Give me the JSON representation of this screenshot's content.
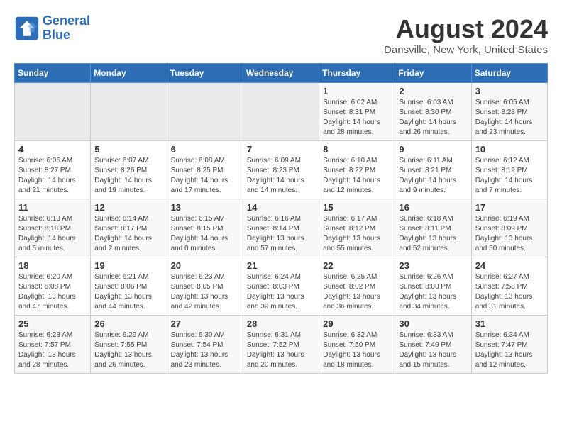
{
  "header": {
    "logo_line1": "General",
    "logo_line2": "Blue",
    "month_title": "August 2024",
    "location": "Dansville, New York, United States"
  },
  "days_of_week": [
    "Sunday",
    "Monday",
    "Tuesday",
    "Wednesday",
    "Thursday",
    "Friday",
    "Saturday"
  ],
  "weeks": [
    [
      {
        "day": "",
        "info": ""
      },
      {
        "day": "",
        "info": ""
      },
      {
        "day": "",
        "info": ""
      },
      {
        "day": "",
        "info": ""
      },
      {
        "day": "1",
        "info": "Sunrise: 6:02 AM\nSunset: 8:31 PM\nDaylight: 14 hours\nand 28 minutes."
      },
      {
        "day": "2",
        "info": "Sunrise: 6:03 AM\nSunset: 8:30 PM\nDaylight: 14 hours\nand 26 minutes."
      },
      {
        "day": "3",
        "info": "Sunrise: 6:05 AM\nSunset: 8:28 PM\nDaylight: 14 hours\nand 23 minutes."
      }
    ],
    [
      {
        "day": "4",
        "info": "Sunrise: 6:06 AM\nSunset: 8:27 PM\nDaylight: 14 hours\nand 21 minutes."
      },
      {
        "day": "5",
        "info": "Sunrise: 6:07 AM\nSunset: 8:26 PM\nDaylight: 14 hours\nand 19 minutes."
      },
      {
        "day": "6",
        "info": "Sunrise: 6:08 AM\nSunset: 8:25 PM\nDaylight: 14 hours\nand 17 minutes."
      },
      {
        "day": "7",
        "info": "Sunrise: 6:09 AM\nSunset: 8:23 PM\nDaylight: 14 hours\nand 14 minutes."
      },
      {
        "day": "8",
        "info": "Sunrise: 6:10 AM\nSunset: 8:22 PM\nDaylight: 14 hours\nand 12 minutes."
      },
      {
        "day": "9",
        "info": "Sunrise: 6:11 AM\nSunset: 8:21 PM\nDaylight: 14 hours\nand 9 minutes."
      },
      {
        "day": "10",
        "info": "Sunrise: 6:12 AM\nSunset: 8:19 PM\nDaylight: 14 hours\nand 7 minutes."
      }
    ],
    [
      {
        "day": "11",
        "info": "Sunrise: 6:13 AM\nSunset: 8:18 PM\nDaylight: 14 hours\nand 5 minutes."
      },
      {
        "day": "12",
        "info": "Sunrise: 6:14 AM\nSunset: 8:17 PM\nDaylight: 14 hours\nand 2 minutes."
      },
      {
        "day": "13",
        "info": "Sunrise: 6:15 AM\nSunset: 8:15 PM\nDaylight: 14 hours\nand 0 minutes."
      },
      {
        "day": "14",
        "info": "Sunrise: 6:16 AM\nSunset: 8:14 PM\nDaylight: 13 hours\nand 57 minutes."
      },
      {
        "day": "15",
        "info": "Sunrise: 6:17 AM\nSunset: 8:12 PM\nDaylight: 13 hours\nand 55 minutes."
      },
      {
        "day": "16",
        "info": "Sunrise: 6:18 AM\nSunset: 8:11 PM\nDaylight: 13 hours\nand 52 minutes."
      },
      {
        "day": "17",
        "info": "Sunrise: 6:19 AM\nSunset: 8:09 PM\nDaylight: 13 hours\nand 50 minutes."
      }
    ],
    [
      {
        "day": "18",
        "info": "Sunrise: 6:20 AM\nSunset: 8:08 PM\nDaylight: 13 hours\nand 47 minutes."
      },
      {
        "day": "19",
        "info": "Sunrise: 6:21 AM\nSunset: 8:06 PM\nDaylight: 13 hours\nand 44 minutes."
      },
      {
        "day": "20",
        "info": "Sunrise: 6:23 AM\nSunset: 8:05 PM\nDaylight: 13 hours\nand 42 minutes."
      },
      {
        "day": "21",
        "info": "Sunrise: 6:24 AM\nSunset: 8:03 PM\nDaylight: 13 hours\nand 39 minutes."
      },
      {
        "day": "22",
        "info": "Sunrise: 6:25 AM\nSunset: 8:02 PM\nDaylight: 13 hours\nand 36 minutes."
      },
      {
        "day": "23",
        "info": "Sunrise: 6:26 AM\nSunset: 8:00 PM\nDaylight: 13 hours\nand 34 minutes."
      },
      {
        "day": "24",
        "info": "Sunrise: 6:27 AM\nSunset: 7:58 PM\nDaylight: 13 hours\nand 31 minutes."
      }
    ],
    [
      {
        "day": "25",
        "info": "Sunrise: 6:28 AM\nSunset: 7:57 PM\nDaylight: 13 hours\nand 28 minutes."
      },
      {
        "day": "26",
        "info": "Sunrise: 6:29 AM\nSunset: 7:55 PM\nDaylight: 13 hours\nand 26 minutes."
      },
      {
        "day": "27",
        "info": "Sunrise: 6:30 AM\nSunset: 7:54 PM\nDaylight: 13 hours\nand 23 minutes."
      },
      {
        "day": "28",
        "info": "Sunrise: 6:31 AM\nSunset: 7:52 PM\nDaylight: 13 hours\nand 20 minutes."
      },
      {
        "day": "29",
        "info": "Sunrise: 6:32 AM\nSunset: 7:50 PM\nDaylight: 13 hours\nand 18 minutes."
      },
      {
        "day": "30",
        "info": "Sunrise: 6:33 AM\nSunset: 7:49 PM\nDaylight: 13 hours\nand 15 minutes."
      },
      {
        "day": "31",
        "info": "Sunrise: 6:34 AM\nSunset: 7:47 PM\nDaylight: 13 hours\nand 12 minutes."
      }
    ]
  ]
}
